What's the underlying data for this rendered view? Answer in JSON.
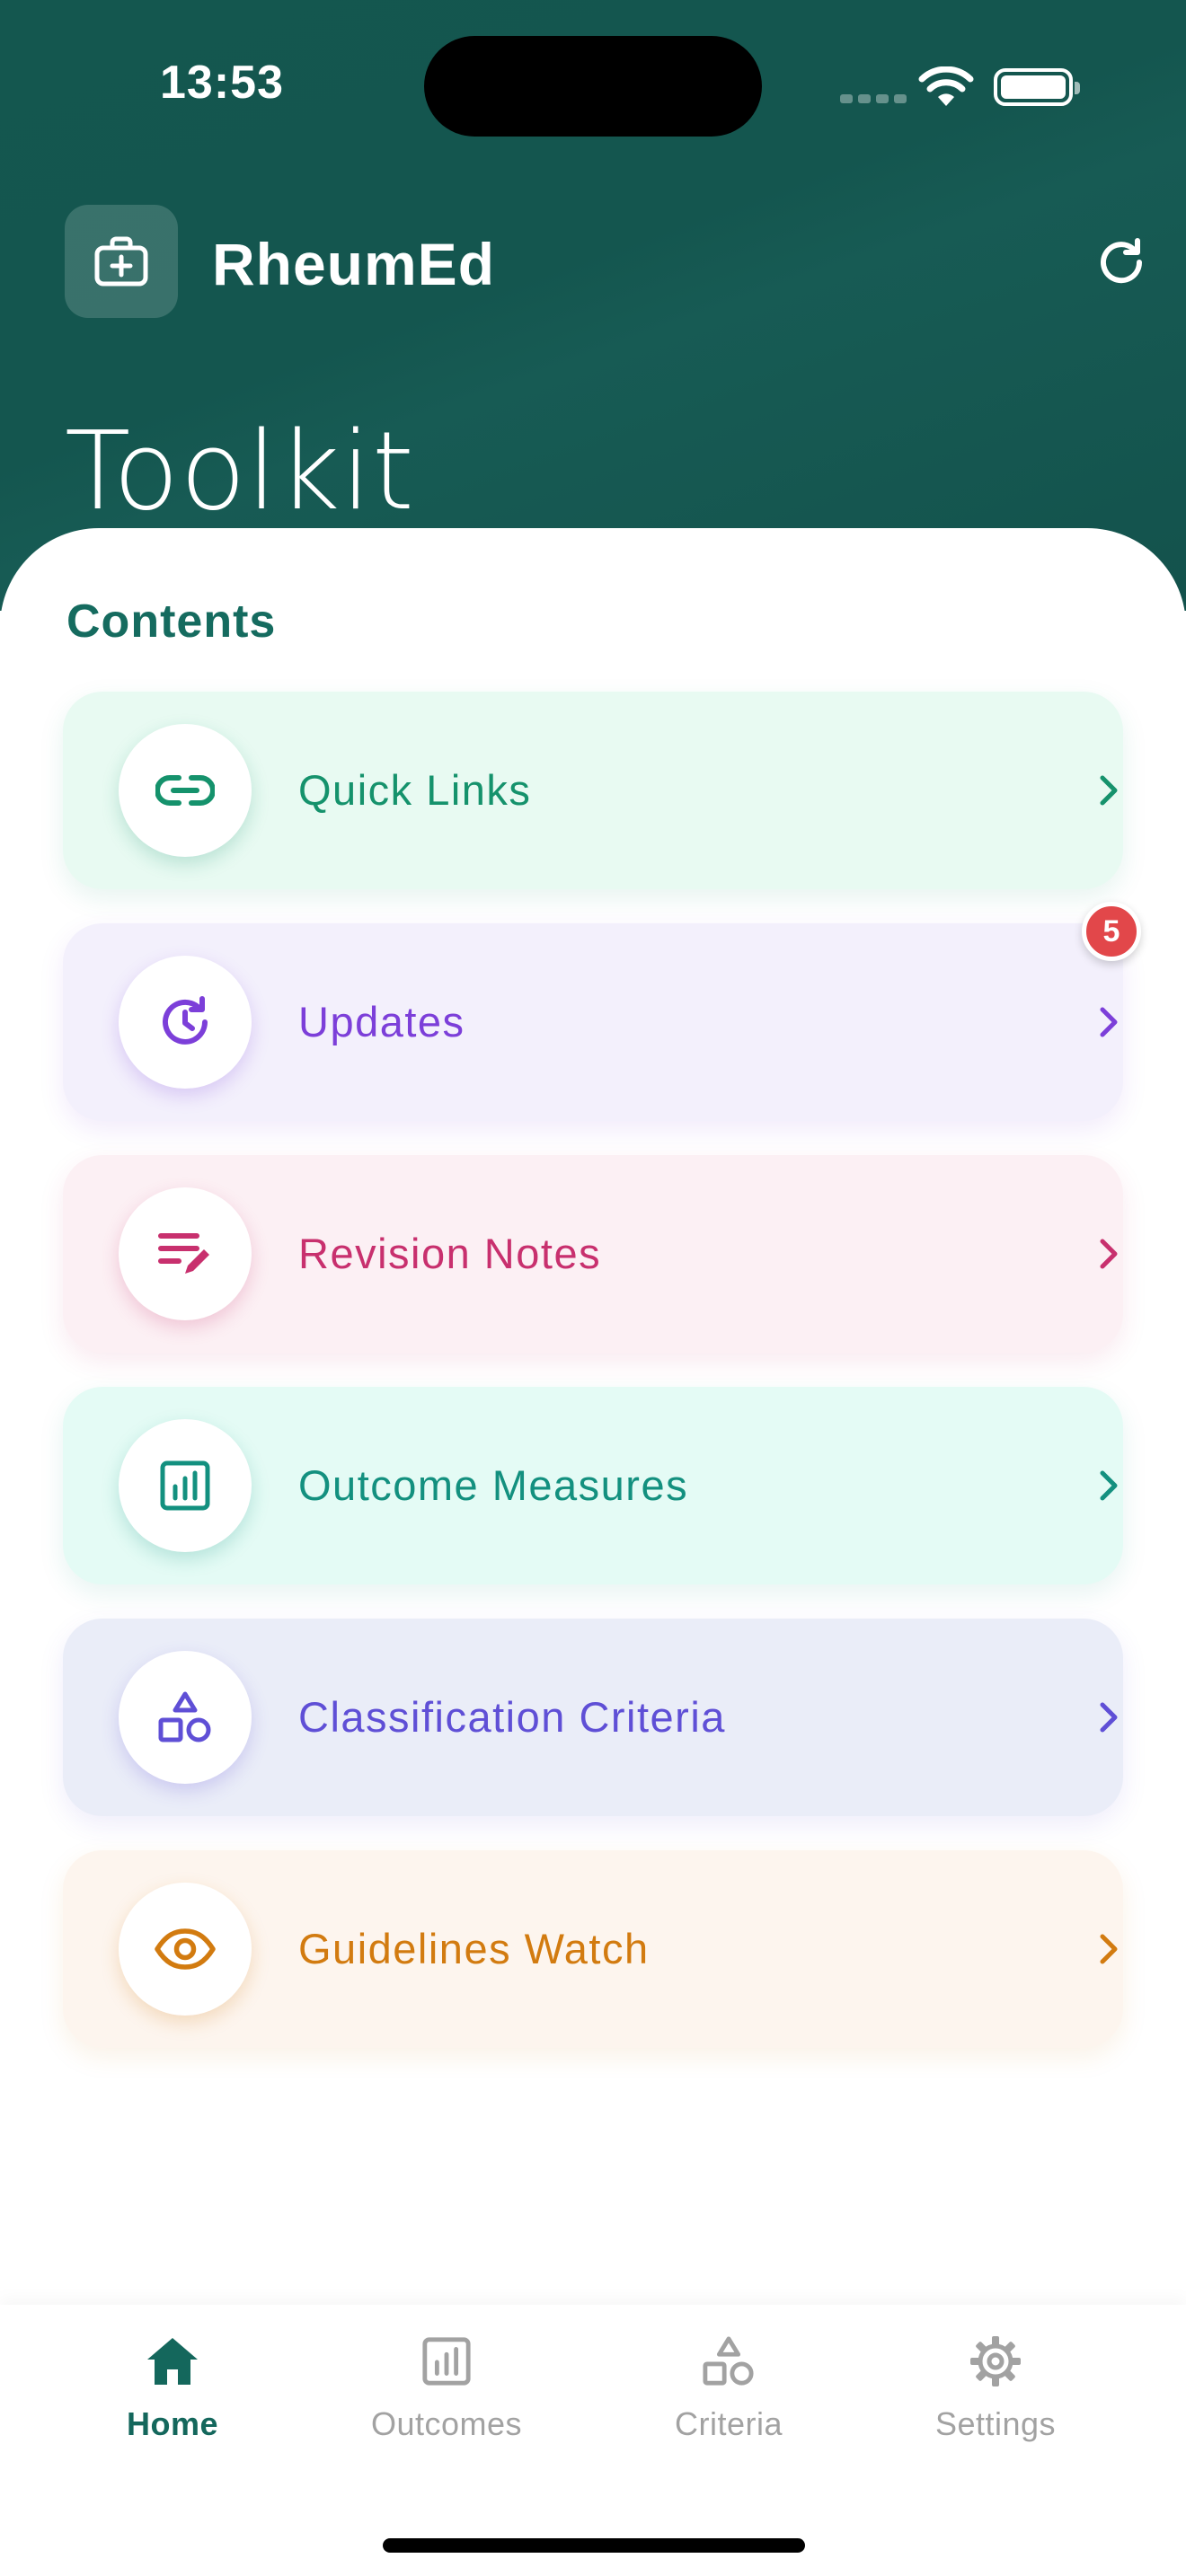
{
  "status_bar": {
    "time": "13:53"
  },
  "header": {
    "app_name": "RheumEd",
    "page_title": "Toolkit"
  },
  "contents": {
    "section_title": "Contents",
    "items": [
      {
        "label": "Quick Links",
        "icon": "link-icon",
        "color": "#15926c",
        "bg": "#e8faf2"
      },
      {
        "label": "Updates",
        "icon": "history-icon",
        "color": "#7c3fd9",
        "bg": "#f3f0fc",
        "badge": "5"
      },
      {
        "label": "Revision Notes",
        "icon": "notes-edit-icon",
        "color": "#c8306e",
        "bg": "#fcf0f4"
      },
      {
        "label": "Outcome Measures",
        "icon": "chart-icon",
        "color": "#13907f",
        "bg": "#e4fbf5"
      },
      {
        "label": "Classification Criteria",
        "icon": "shapes-icon",
        "color": "#5f4fd6",
        "bg": "#eaedf8"
      },
      {
        "label": "Guidelines Watch",
        "icon": "eye-icon",
        "color": "#d27b10",
        "bg": "#fdf5ee"
      }
    ]
  },
  "tab_bar": {
    "active_color": "#14675c",
    "inactive_color": "#a2a2a2",
    "tabs": [
      {
        "label": "Home",
        "icon": "home-icon",
        "active": true
      },
      {
        "label": "Outcomes",
        "icon": "chart-icon",
        "active": false
      },
      {
        "label": "Criteria",
        "icon": "shapes-icon",
        "active": false
      },
      {
        "label": "Settings",
        "icon": "gear-icon",
        "active": false
      }
    ]
  }
}
